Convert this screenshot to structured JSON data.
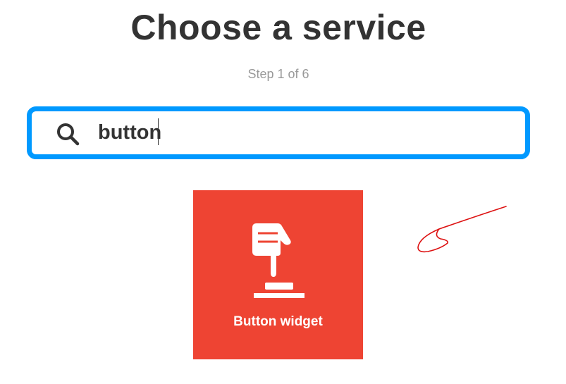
{
  "header": {
    "title": "Choose a service",
    "step": "Step 1 of 6"
  },
  "search": {
    "value": "button",
    "icon": "search-icon",
    "border_color": "#0099ff"
  },
  "results": [
    {
      "label": "Button widget",
      "icon": "pointing-finger-button-icon",
      "background": "#ee4433"
    }
  ],
  "annotation": {
    "icon": "hand-drawn-arrow-icon",
    "color": "#dd1111"
  }
}
